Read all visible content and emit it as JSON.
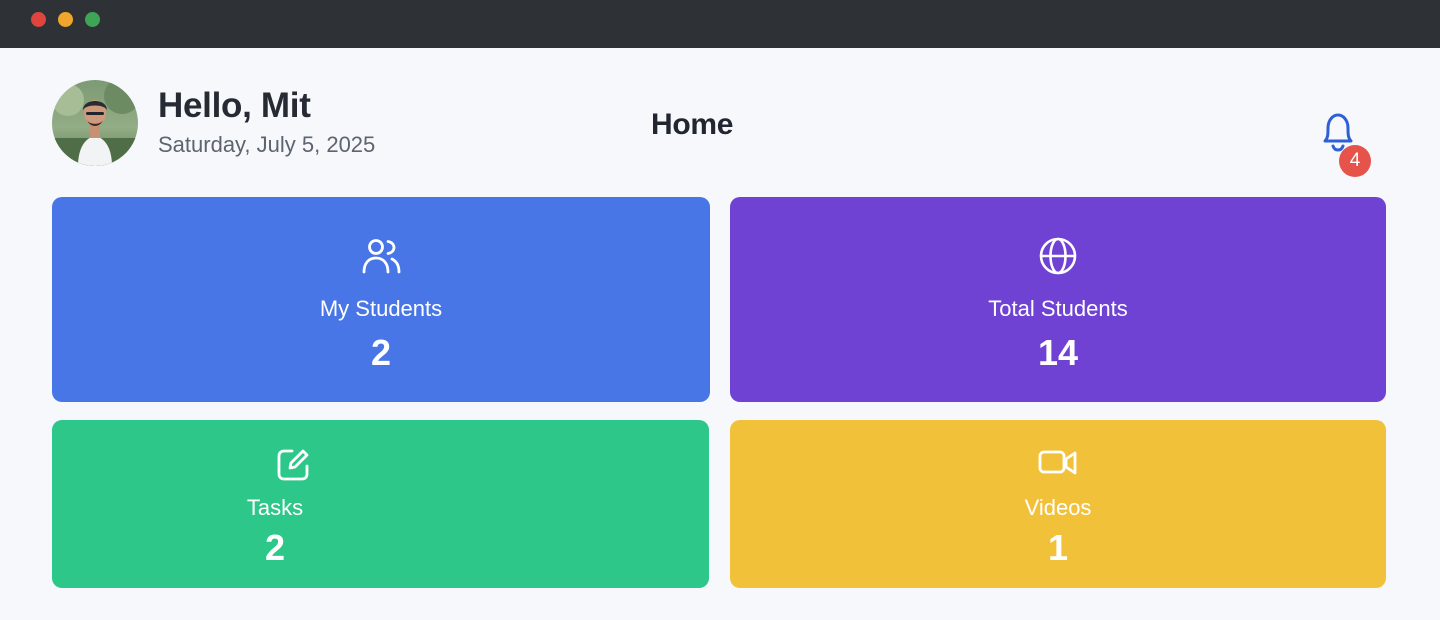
{
  "window": {
    "controls": [
      "close",
      "minimize",
      "maximize"
    ]
  },
  "header": {
    "greeting": "Hello, Mit",
    "date": "Saturday, July 5, 2025",
    "title": "Home",
    "notifications": {
      "icon": "bell-icon",
      "count": "4"
    }
  },
  "cards": [
    {
      "label": "My Students",
      "value": "2",
      "icon": "users-icon",
      "color": "#4876e6"
    },
    {
      "label": "Total Students",
      "value": "14",
      "icon": "globe-icon",
      "color": "#6f42d4"
    },
    {
      "label": "Tasks",
      "value": "2",
      "icon": "edit-square-icon",
      "color": "#2cc789"
    },
    {
      "label": "Videos",
      "value": "1",
      "icon": "video-icon",
      "color": "#f2c13a"
    }
  ],
  "colors": {
    "background": "#f6f8fb",
    "titlebar": "#2e3136",
    "bell": "#2f5fd6",
    "badge": "#e5534b"
  }
}
